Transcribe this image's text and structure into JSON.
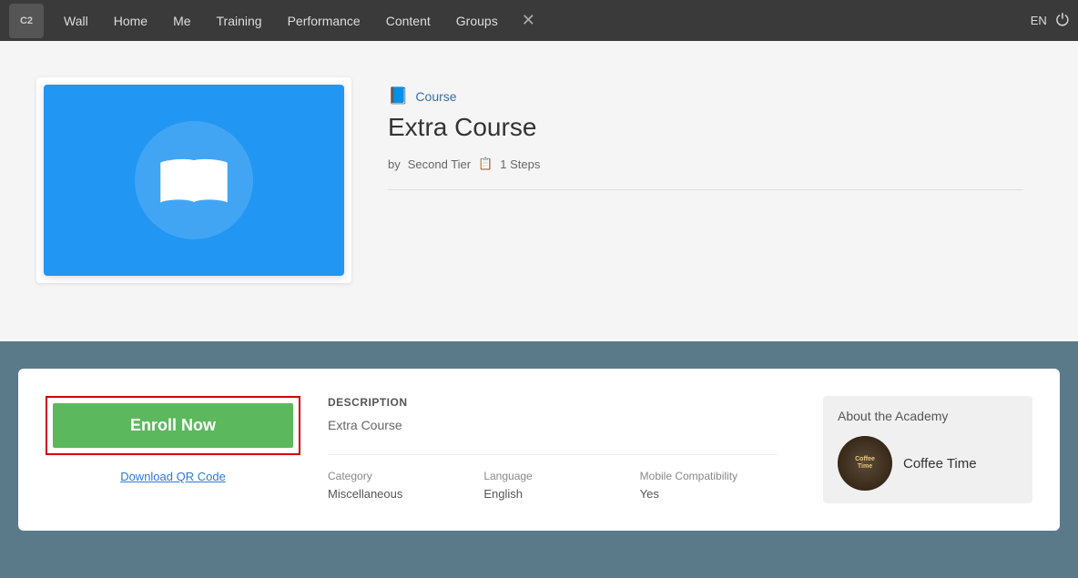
{
  "navbar": {
    "logo_text": "C2",
    "items": [
      {
        "label": "Wall",
        "id": "wall"
      },
      {
        "label": "Home",
        "id": "home"
      },
      {
        "label": "Me",
        "id": "me"
      },
      {
        "label": "Training",
        "id": "training"
      },
      {
        "label": "Performance",
        "id": "performance"
      },
      {
        "label": "Content",
        "id": "content"
      },
      {
        "label": "Groups",
        "id": "groups"
      }
    ],
    "lang": "EN"
  },
  "course": {
    "type_label": "Course",
    "title": "Extra Course",
    "by_label": "by",
    "author": "Second Tier",
    "steps_icon": "📋",
    "steps": "1 Steps"
  },
  "bottom": {
    "enroll_button": "Enroll Now",
    "download_qr": "Download QR Code",
    "description_heading": "DESCRIPTION",
    "description_text": "Extra Course",
    "category_label": "Category",
    "category_value": "Miscellaneous",
    "language_label": "Language",
    "language_value": "English",
    "mobile_label": "Mobile Compatibility",
    "mobile_value": "Yes",
    "academy_heading": "About the Academy",
    "academy_name": "Coffee Time"
  }
}
